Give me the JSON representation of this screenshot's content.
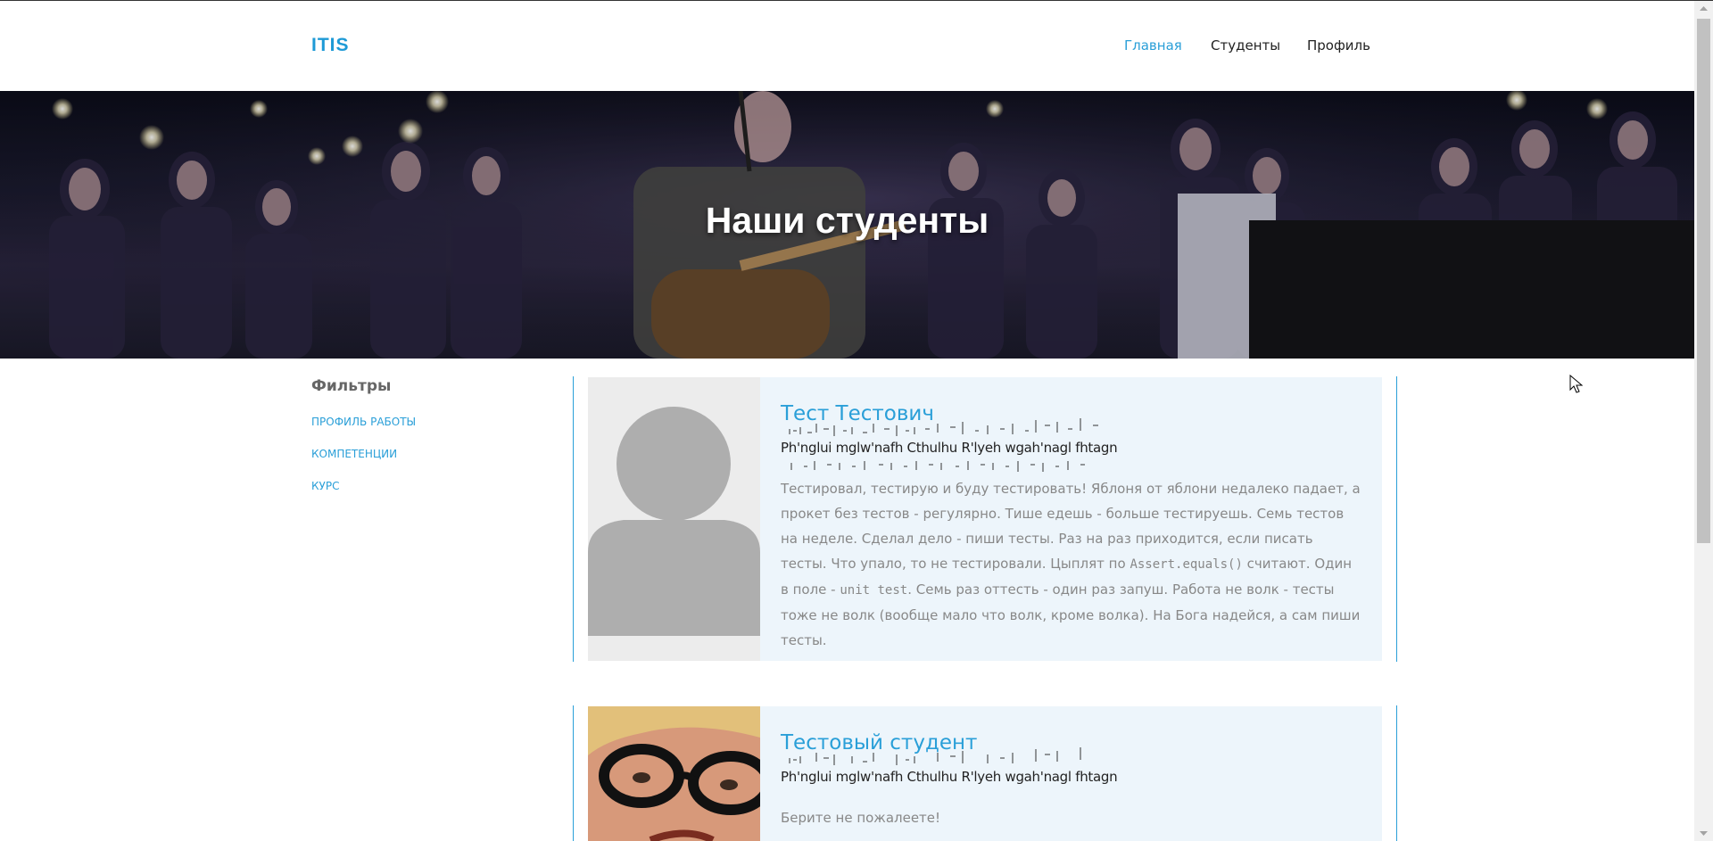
{
  "brand": {
    "logo_text": "ITIS"
  },
  "nav": {
    "items": [
      "Главная",
      "Студенты",
      "Профиль"
    ],
    "active_index": 0
  },
  "hero": {
    "title": "Наши студенты"
  },
  "sidebar": {
    "title": "Фильтры",
    "links": [
      "ПРОФИЛЬ РАБОТЫ",
      "КОМПЕТЕНЦИИ",
      "КУРС"
    ]
  },
  "students": [
    {
      "name": "Тест Тестович",
      "subtitle": "Ph'nglui mglw'nafh Cthulhu R'lyeh wgah'nagl fhtagn",
      "description_parts": [
        "Тестировал, тестирую и буду тестировать! Яблоня от яблони недалеко падает, а прокет без тестов - регулярно. Тише едешь - больше тестируешь. Семь тестов на неделе. Сделал дело - пиши тесты. Раз на раз приходится, если писать тесты. Что упало, то не тестировали. Цыплят по ",
        "Assert.equals()",
        " считают. Один в поле - ",
        "unit test",
        ". Семь раз оттесть - один раз запуш. Работа не волк - тесты тоже не волк (вообще мало что волк, кроме волка). На Бога надейся, а сам пиши тесты."
      ],
      "photo": "default-avatar"
    },
    {
      "name": "Тестовый студент",
      "subtitle": "Ph'nglui mglw'nafh Cthulhu R'lyeh wgah'nagl fhtagn",
      "description": "Берите не пожалеете!",
      "photo": "face-with-glasses"
    }
  ],
  "colors": {
    "accent": "#2a9fd8",
    "card_bg": "#edf5fb",
    "text_muted": "#888888"
  }
}
